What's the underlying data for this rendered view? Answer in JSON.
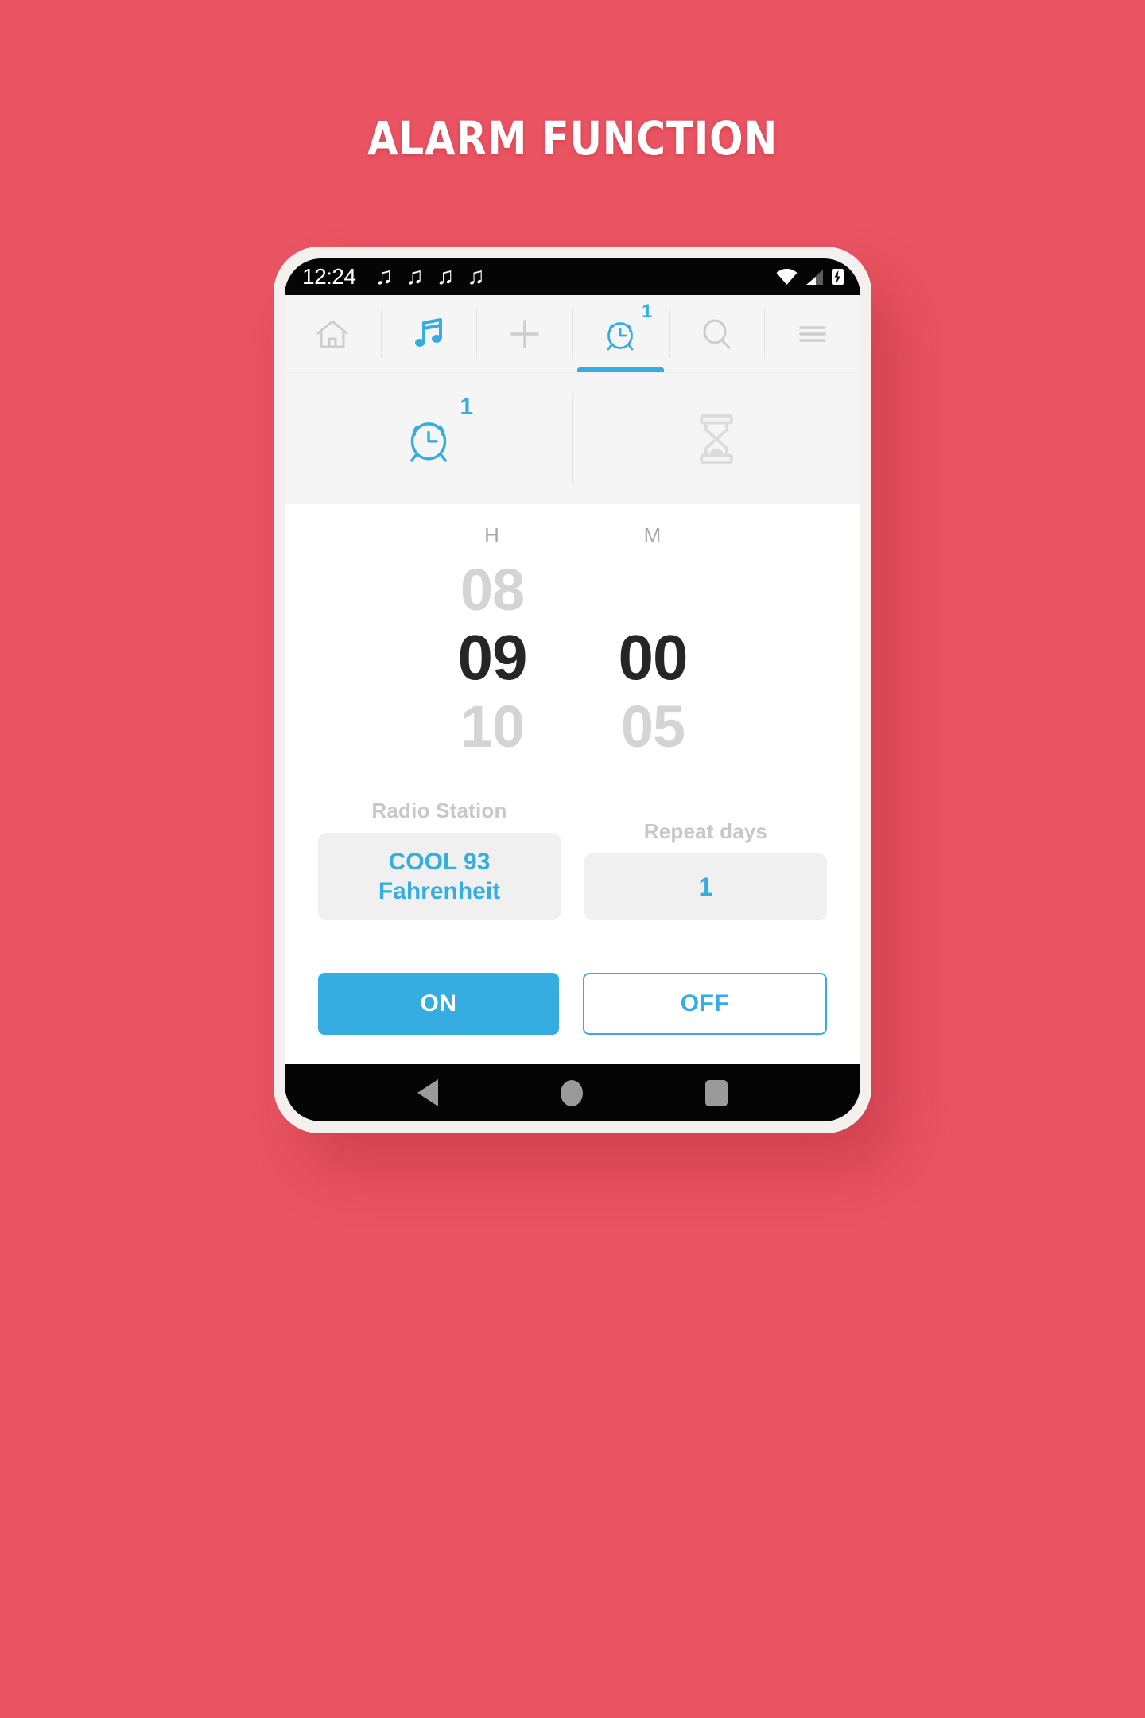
{
  "header": {
    "title": "ALARM FUNCTION"
  },
  "colors": {
    "background": "#ea5462",
    "accent": "#36ade0",
    "muted": "#c8c8c8",
    "dark": "#262626"
  },
  "status_bar": {
    "time": "12:24",
    "music_notes": [
      "♫",
      "♫",
      "♫",
      "♫"
    ],
    "icons": [
      "wifi-icon",
      "signal-icon",
      "battery-charging-icon"
    ]
  },
  "top_nav": {
    "items": [
      {
        "name": "home",
        "icon": "home-icon",
        "active": false,
        "badge": null
      },
      {
        "name": "music",
        "icon": "music-note-icon",
        "active": false,
        "badge": null
      },
      {
        "name": "add",
        "icon": "plus-icon",
        "active": false,
        "badge": null
      },
      {
        "name": "alarm",
        "icon": "alarm-clock-icon",
        "active": true,
        "badge": "1"
      },
      {
        "name": "search",
        "icon": "search-icon",
        "active": false,
        "badge": null
      },
      {
        "name": "menu",
        "icon": "hamburger-menu-icon",
        "active": false,
        "badge": null
      }
    ]
  },
  "sub_tabs": {
    "items": [
      {
        "name": "alarm",
        "icon": "alarm-clock-icon",
        "active": true,
        "badge": "1"
      },
      {
        "name": "timer",
        "icon": "hourglass-icon",
        "active": false,
        "badge": null
      }
    ]
  },
  "time_picker": {
    "hour": {
      "label": "H",
      "previous": "08",
      "selected": "09",
      "next": "10"
    },
    "minute": {
      "label": "M",
      "previous": "",
      "selected": "00",
      "next": "05"
    }
  },
  "settings": {
    "radio_station": {
      "label": "Radio Station",
      "value": "COOL 93 Fahrenheit"
    },
    "repeat_days": {
      "label": "Repeat days",
      "value": "1"
    }
  },
  "actions": {
    "on_label": "ON",
    "off_label": "OFF"
  },
  "android_nav": {
    "back": "back-triangle-icon",
    "home": "home-circle-icon",
    "recents": "recents-square-icon"
  }
}
